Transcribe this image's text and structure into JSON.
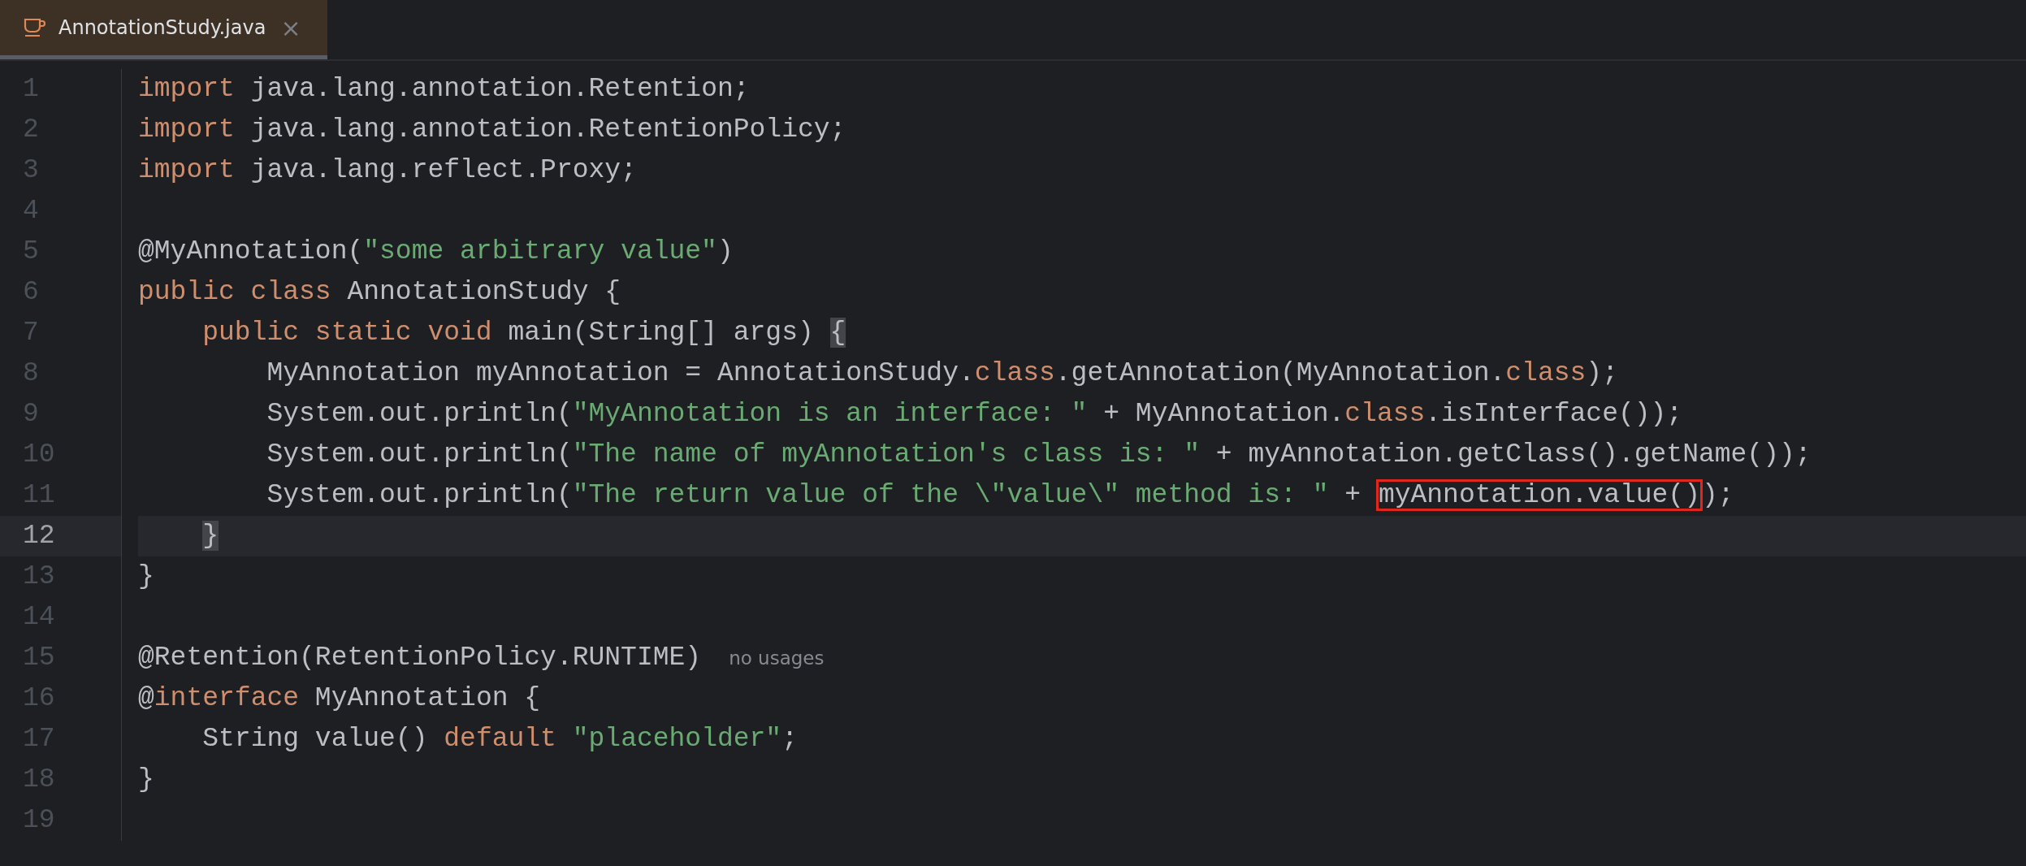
{
  "tabs": [
    {
      "title": "AnnotationStudy.java",
      "close": "×",
      "selected": true
    }
  ],
  "editor": {
    "lines": [
      {
        "number": "1",
        "current": false,
        "tokens": [
          {
            "kind": "keyword",
            "text": "import"
          },
          {
            "kind": "plain",
            "text": " java.lang.annotation.Retention;"
          }
        ]
      },
      {
        "number": "2",
        "current": false,
        "tokens": [
          {
            "kind": "keyword",
            "text": "import"
          },
          {
            "kind": "plain",
            "text": " java.lang.annotation.RetentionPolicy;"
          }
        ]
      },
      {
        "number": "3",
        "current": false,
        "tokens": [
          {
            "kind": "keyword",
            "text": "import"
          },
          {
            "kind": "plain",
            "text": " java.lang.reflect.Proxy;"
          }
        ]
      },
      {
        "number": "4",
        "current": false
      },
      {
        "number": "5",
        "current": false,
        "tokens": [
          {
            "kind": "plain",
            "text": "@MyAnnotation("
          },
          {
            "kind": "string",
            "text": "\"some arbitrary value\""
          },
          {
            "kind": "plain",
            "text": ")"
          }
        ]
      },
      {
        "number": "6",
        "current": false,
        "tokens": [
          {
            "kind": "keyword",
            "text": "public class"
          },
          {
            "kind": "plain",
            "text": " AnnotationStudy {"
          }
        ]
      },
      {
        "number": "7",
        "current": false,
        "tokens": [
          {
            "kind": "keyword",
            "text": "    public static void"
          },
          {
            "kind": "plain",
            "text": " main(String[] args) "
          },
          {
            "kind": "brace_match",
            "text": "{"
          }
        ]
      },
      {
        "number": "8",
        "current": false,
        "tokens": [
          {
            "kind": "plain",
            "text": "        MyAnnotation myAnnotation = AnnotationStudy."
          },
          {
            "kind": "keyword",
            "text": "class"
          },
          {
            "kind": "plain",
            "text": ".getAnnotation(MyAnnotation."
          },
          {
            "kind": "keyword",
            "text": "class"
          },
          {
            "kind": "plain",
            "text": ");"
          }
        ]
      },
      {
        "number": "9",
        "current": false,
        "tokens": [
          {
            "kind": "plain",
            "text": "        System.out.println("
          },
          {
            "kind": "string",
            "text": "\"MyAnnotation is an interface: \""
          },
          {
            "kind": "plain",
            "text": " + MyAnnotation."
          },
          {
            "kind": "keyword",
            "text": "class"
          },
          {
            "kind": "plain",
            "text": ".isInterface());"
          }
        ]
      },
      {
        "number": "10",
        "current": false,
        "tokens": [
          {
            "kind": "plain",
            "text": "        System.out.println("
          },
          {
            "kind": "string",
            "text": "\"The name of myAnnotation's class is: \""
          },
          {
            "kind": "plain",
            "text": " + myAnnotation.getClass().getName());"
          }
        ]
      },
      {
        "number": "11",
        "current": false,
        "tokens": [
          {
            "kind": "plain",
            "text": "        System.out.println("
          },
          {
            "kind": "string",
            "text": "\"The return value of the \\\"value\\\" method is: \""
          },
          {
            "kind": "plain",
            "text": " + "
          },
          {
            "kind": "boxed",
            "text": "myAnnotation.value()"
          },
          {
            "kind": "plain",
            "text": ");"
          }
        ]
      },
      {
        "number": "12",
        "current": true,
        "tokens": [
          {
            "kind": "brace_match",
            "text": "    }"
          }
        ]
      },
      {
        "number": "13",
        "current": false,
        "tokens": [
          {
            "kind": "plain",
            "text": "}"
          }
        ]
      },
      {
        "number": "14",
        "current": false
      },
      {
        "number": "15",
        "current": false,
        "tokens": [
          {
            "kind": "plain",
            "text": "@Retention(RetentionPolicy.RUNTIME)"
          }
        ],
        "hint": "no usages"
      },
      {
        "number": "16",
        "current": false,
        "tokens": [
          {
            "kind": "plain",
            "text": "@"
          },
          {
            "kind": "keyword",
            "text": "interface"
          },
          {
            "kind": "plain",
            "text": " MyAnnotation {"
          }
        ]
      },
      {
        "number": "17",
        "current": false,
        "tokens": [
          {
            "kind": "plain",
            "text": "    String value() "
          },
          {
            "kind": "keyword",
            "text": "default"
          },
          {
            "kind": "string",
            "text": " \"placeholder\""
          },
          {
            "kind": "plain",
            "text": ";"
          }
        ]
      },
      {
        "number": "18",
        "current": false,
        "tokens": [
          {
            "kind": "plain",
            "text": "}"
          }
        ]
      },
      {
        "number": "19",
        "current": false
      }
    ]
  }
}
